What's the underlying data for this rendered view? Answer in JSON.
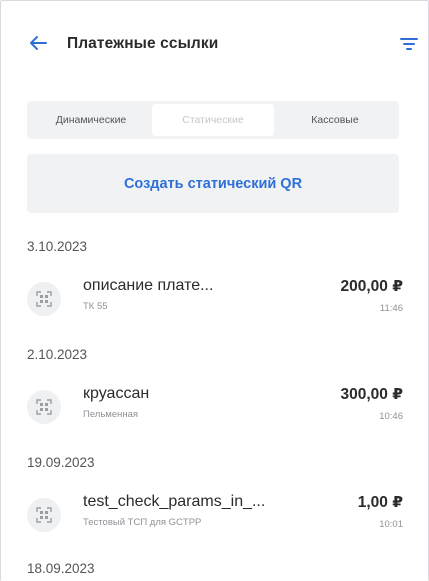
{
  "header": {
    "title": "Платежные ссылки",
    "back_icon": "arrow-left-icon",
    "filter_icon": "filter-icon",
    "accent": "#2d6fd6"
  },
  "tabs": [
    {
      "label": "Динамические",
      "active": false
    },
    {
      "label": "Статические",
      "active": true
    },
    {
      "label": "Кассовые",
      "active": false
    }
  ],
  "create_button": {
    "label": "Создать статический QR"
  },
  "groups": [
    {
      "date": "3.10.2023",
      "items": [
        {
          "title": "описание плате...",
          "subtitle": "ТК 55",
          "amount": "200,00 ₽",
          "time": "11:46"
        }
      ]
    },
    {
      "date": "2.10.2023",
      "items": [
        {
          "title": "круассан",
          "subtitle": "Пельменная",
          "amount": "300,00 ₽",
          "time": "10:46"
        }
      ]
    },
    {
      "date": "19.09.2023",
      "items": [
        {
          "title": "test_check_params_in_...",
          "subtitle": "Тестовый ТСП для GCTPP",
          "amount": "1,00 ₽",
          "time": "10:01"
        }
      ]
    },
    {
      "date": "18.09.2023",
      "items": []
    }
  ],
  "icons": {
    "row_icon": "qr-code-icon"
  }
}
